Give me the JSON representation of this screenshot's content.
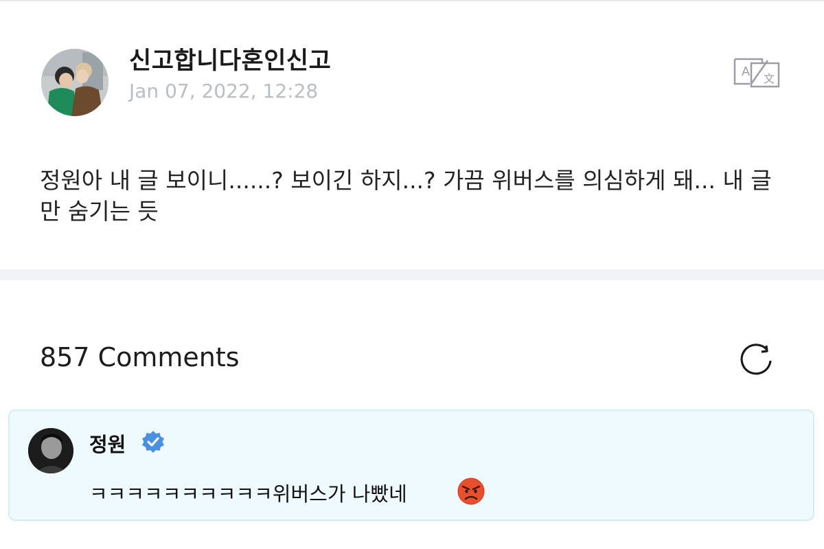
{
  "post": {
    "author": "신고합니다혼인신고",
    "date": "Jan 07, 2022, 12:28",
    "body": "정원아 내 글 보이니......? 보이긴 하지...? 가끔 위버스를 의심하게 돼... 내 글만 숨기는 듯",
    "translate_icon": "translate-icon"
  },
  "comments": {
    "count_label": "857 Comments",
    "refresh_icon": "refresh-icon",
    "items": [
      {
        "author": "정원",
        "verified": true,
        "text": "ㅋㅋㅋㅋㅋㅋㅋㅋㅋㅋ위버스가 나빴네",
        "emoji": "angry-face-emoji"
      }
    ]
  },
  "colors": {
    "date_gray": "#b9bec4",
    "comment_bg": "#eefaff",
    "comment_border": "#d5ecf3",
    "verified_blue": "#4a90e2",
    "divider": "#f2f3f6"
  }
}
